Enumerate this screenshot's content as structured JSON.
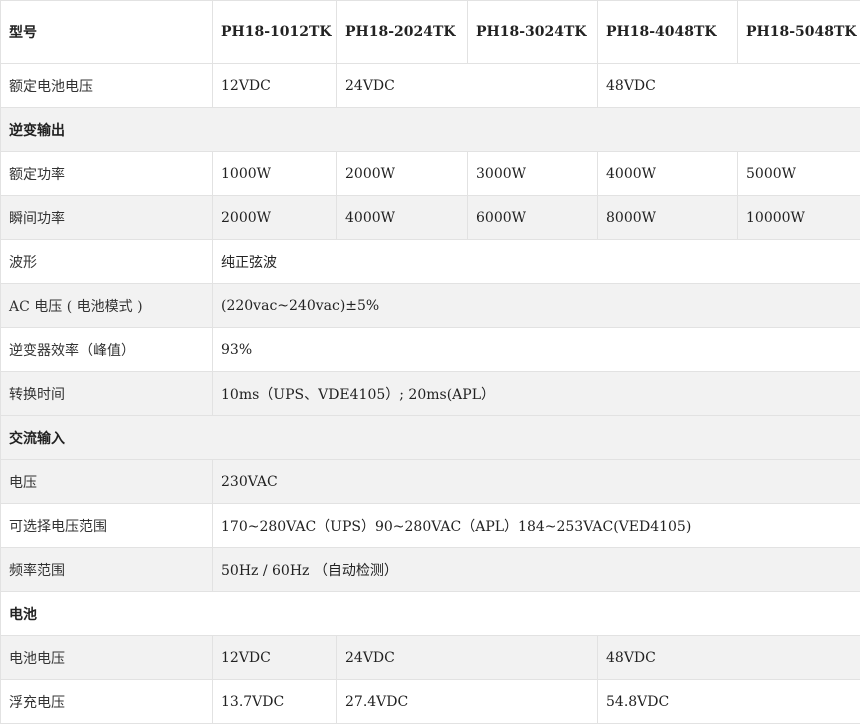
{
  "header": {
    "label": "型号",
    "models": [
      "PH18-1012TK",
      "PH18-2024TK",
      "PH18-3024TK",
      "PH18-4048TK",
      "PH18-5048TK"
    ]
  },
  "rated_battery_voltage": {
    "label": "额定电池电压",
    "v1": "12VDC",
    "v2": "24VDC",
    "v3": "48VDC"
  },
  "inverter_section": {
    "title": "逆变输出"
  },
  "rated_power": {
    "label": "额定功率",
    "values": [
      "1000W",
      "2000W",
      "3000W",
      "4000W",
      "5000W"
    ]
  },
  "peak_power": {
    "label": "瞬间功率",
    "values": [
      "2000W",
      "4000W",
      "6000W",
      "8000W",
      "10000W"
    ]
  },
  "waveform": {
    "label": "波形",
    "value": "纯正弦波"
  },
  "ac_voltage": {
    "label": "AC 电压 ( 电池模式 )",
    "value": "(220vac~240vac)±5%"
  },
  "efficiency": {
    "label": "逆变器效率（峰值）",
    "value": "93%"
  },
  "transfer_time": {
    "label": "转换时间",
    "value": "10ms（UPS、VDE4105）; 20ms(APL）"
  },
  "ac_input_section": {
    "title": "交流输入"
  },
  "input_voltage": {
    "label": "电压",
    "value": "230VAC"
  },
  "voltage_range": {
    "label": "可选择电压范围",
    "value": "170~280VAC（UPS）90~280VAC（APL）184~253VAC(VED4105)"
  },
  "frequency_range": {
    "label": "频率范围",
    "value": "50Hz / 60Hz （自动检测）"
  },
  "battery_section": {
    "title": "电池"
  },
  "battery_voltage": {
    "label": "电池电压",
    "v1": "12VDC",
    "v2": "24VDC",
    "v3": "48VDC"
  },
  "float_voltage": {
    "label": "浮充电压",
    "v1": "13.7VDC",
    "v2": "27.4VDC",
    "v3": "54.8VDC"
  }
}
